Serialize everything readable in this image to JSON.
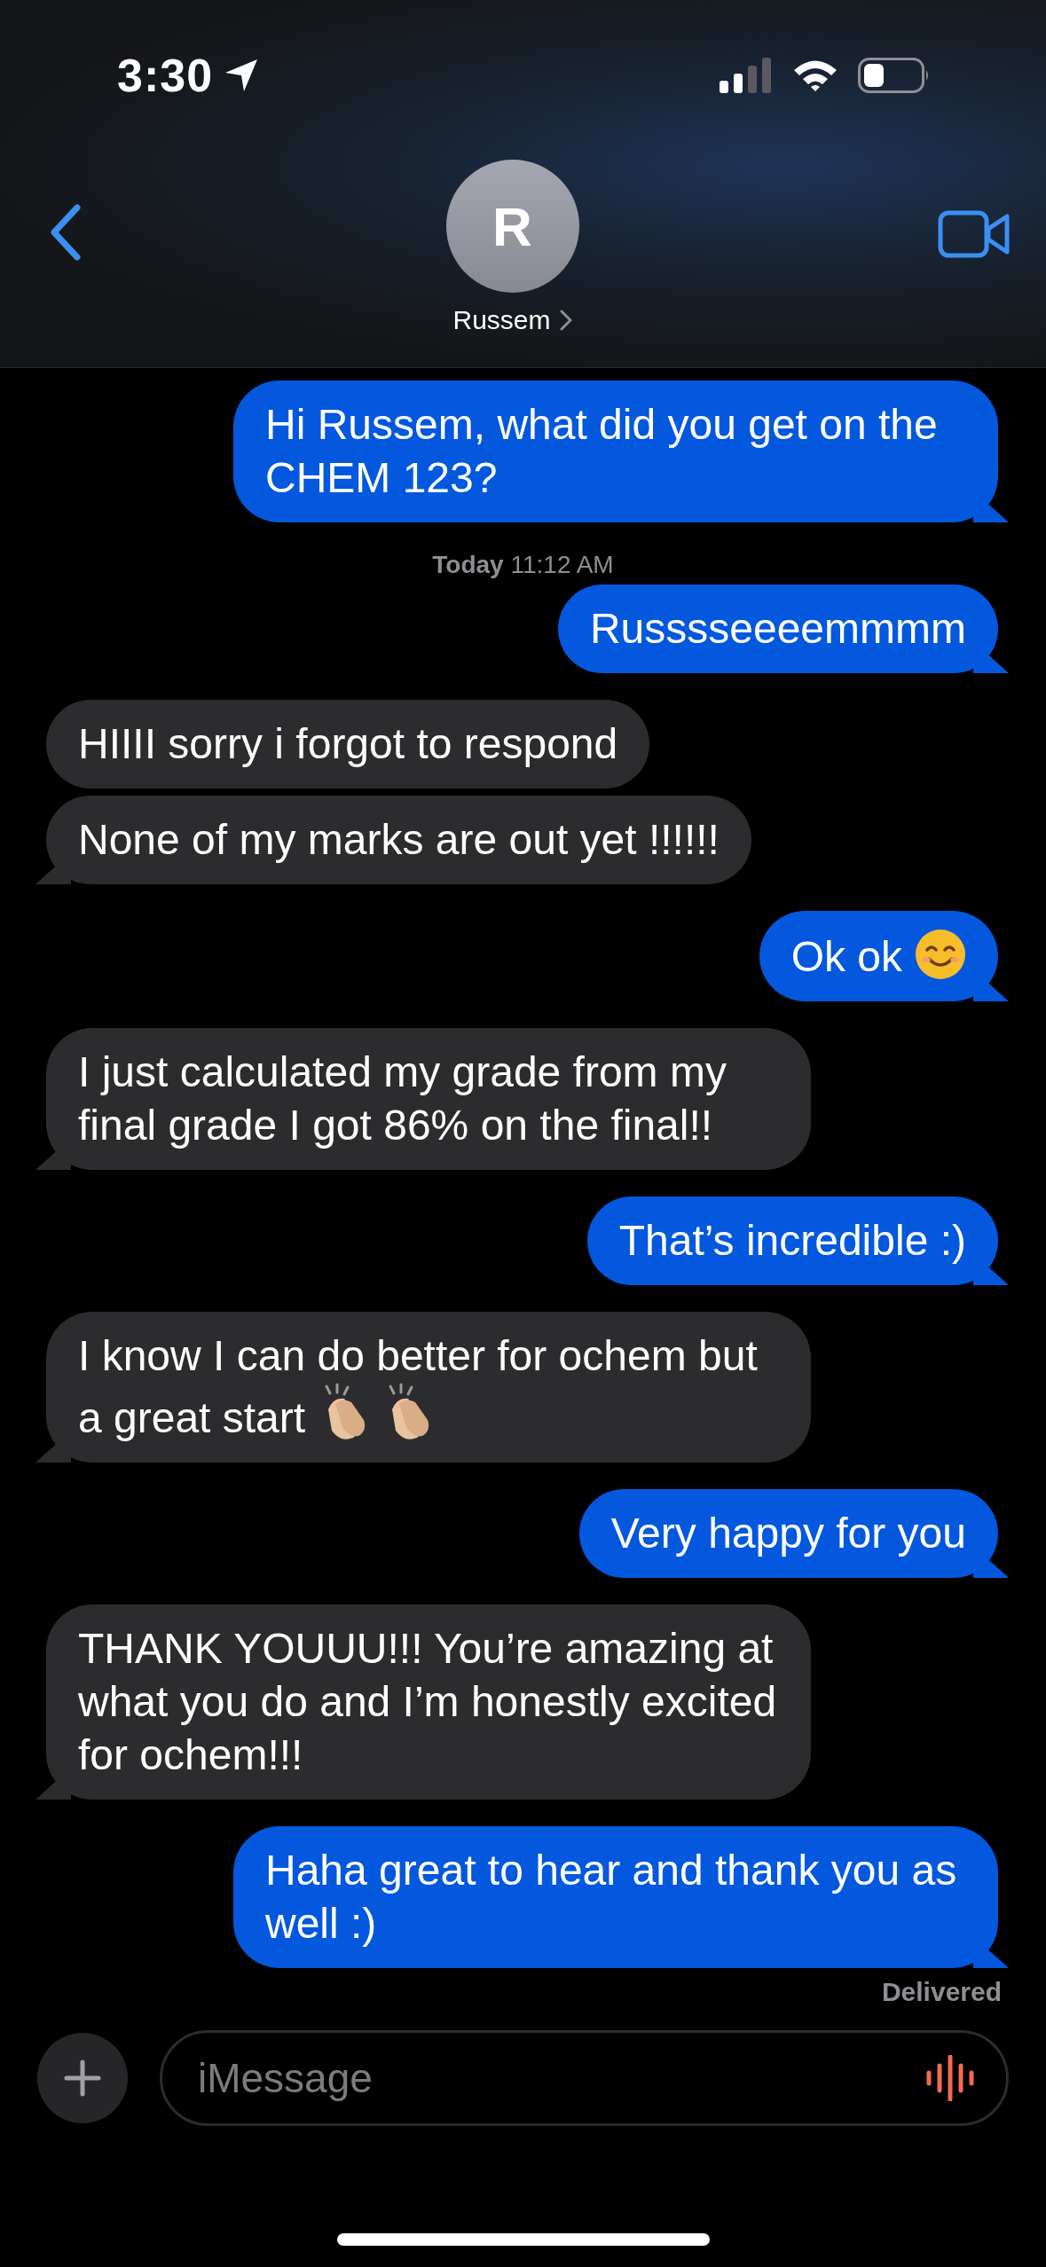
{
  "status_bar": {
    "time": "3:30"
  },
  "header": {
    "avatar_initial": "R",
    "contact_name": "Russem"
  },
  "messages": [
    {
      "kind": "sent",
      "text": "Hi Russem, what did you get on the CHEM 123?"
    },
    {
      "kind": "timestamp",
      "text": "**Today** 11:12 AM"
    },
    {
      "kind": "sent",
      "text": "Russsseeeemmmm"
    },
    {
      "kind": "received",
      "text": "HIIII sorry i forgot to respond"
    },
    {
      "kind": "received",
      "text": "None of my marks are out yet !!!!!!"
    },
    {
      "kind": "sent",
      "text": "Ok ok",
      "icons": [
        {
          "kind": "smile"
        }
      ]
    },
    {
      "kind": "received",
      "text": "I just calculated my grade from my final grade I got 86% on the final!!"
    },
    {
      "kind": "sent",
      "text": "That’s incredible :)"
    },
    {
      "kind": "received",
      "text": "I know I can do better for ochem but a great start",
      "icons": [
        {
          "kind": "clap"
        },
        {
          "kind": "clap"
        }
      ]
    },
    {
      "kind": "sent",
      "text": "Very happy for you"
    },
    {
      "kind": "received",
      "text": "THANK YOUUU!!! You’re amazing at what you do and I’m honestly excited for ochem!!!"
    },
    {
      "kind": "sent",
      "text": "Haha great to hear and thank you as well :)"
    }
  ],
  "delivery_status": "Delivered",
  "composer": {
    "placeholder": "iMessage"
  }
}
